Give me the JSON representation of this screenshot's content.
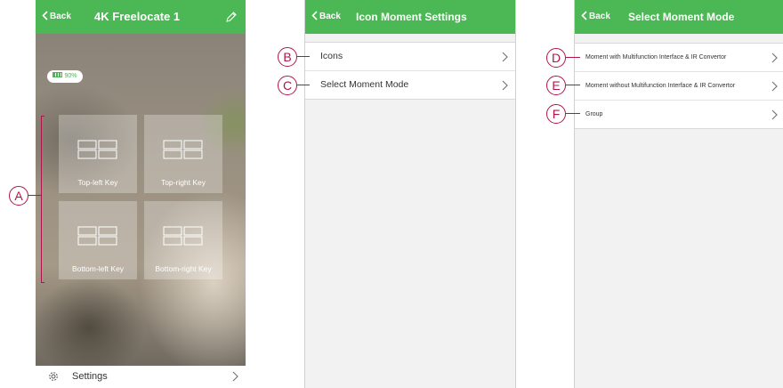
{
  "colors": {
    "header": "#4cb755",
    "callout": "#b0144c"
  },
  "phone1": {
    "back_label": "Back",
    "title": "4K Freelocate 1",
    "edit_icon": "pencil-icon",
    "battery": "90%",
    "keys": [
      "Top-left Key",
      "Top-right Key",
      "Bottom-left Key",
      "Bottom-right Key"
    ],
    "settings_label": "Settings",
    "callout": "A"
  },
  "phone2": {
    "back_label": "Back",
    "title": "Icon Moment Settings",
    "items": [
      {
        "label": "Icons",
        "callout": "B"
      },
      {
        "label": "Select Moment Mode",
        "callout": "C"
      }
    ]
  },
  "phone3": {
    "back_label": "Back",
    "title": "Select Moment Mode",
    "items": [
      {
        "label": "Moment with Multifunction Interface & IR Convertor",
        "callout": "D"
      },
      {
        "label": "Moment without Multifunction Interface & IR Convertor",
        "callout": "E"
      },
      {
        "label": "Group",
        "callout": "F"
      }
    ]
  }
}
